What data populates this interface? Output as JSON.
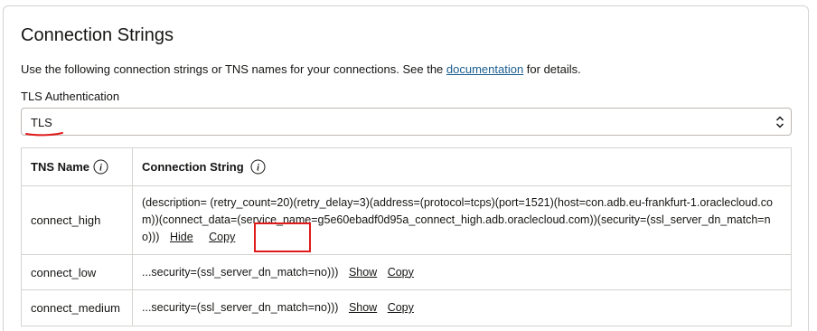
{
  "section": {
    "title": "Connection Strings",
    "description_prefix": "Use the following connection strings or TNS names for your connections. See the ",
    "documentation_link": "documentation",
    "description_suffix": " for details."
  },
  "tls": {
    "label": "TLS Authentication",
    "value": "TLS"
  },
  "table": {
    "headers": {
      "tns_name": "TNS Name",
      "connection_string": "Connection String"
    },
    "rows": [
      {
        "name": "connect_high",
        "string": "(description= (retry_count=20)(retry_delay=3)(address=(protocol=tcps)(port=1521)(host=con.adb.eu-frankfurt-1.oraclecloud.com))(connect_data=(service_name=g5e60ebadf0d95a_connect_high.adb.oraclecloud.com))(security=(ssl_server_dn_match=no)))",
        "toggle": "Hide",
        "copy": "Copy"
      },
      {
        "name": "connect_low",
        "string": "...security=(ssl_server_dn_match=no)))",
        "toggle": "Show",
        "copy": "Copy"
      },
      {
        "name": "connect_medium",
        "string": "...security=(ssl_server_dn_match=no)))",
        "toggle": "Show",
        "copy": "Copy"
      }
    ]
  },
  "colors": {
    "annotation": "#e01b1b",
    "link": "#1a5d8f"
  }
}
